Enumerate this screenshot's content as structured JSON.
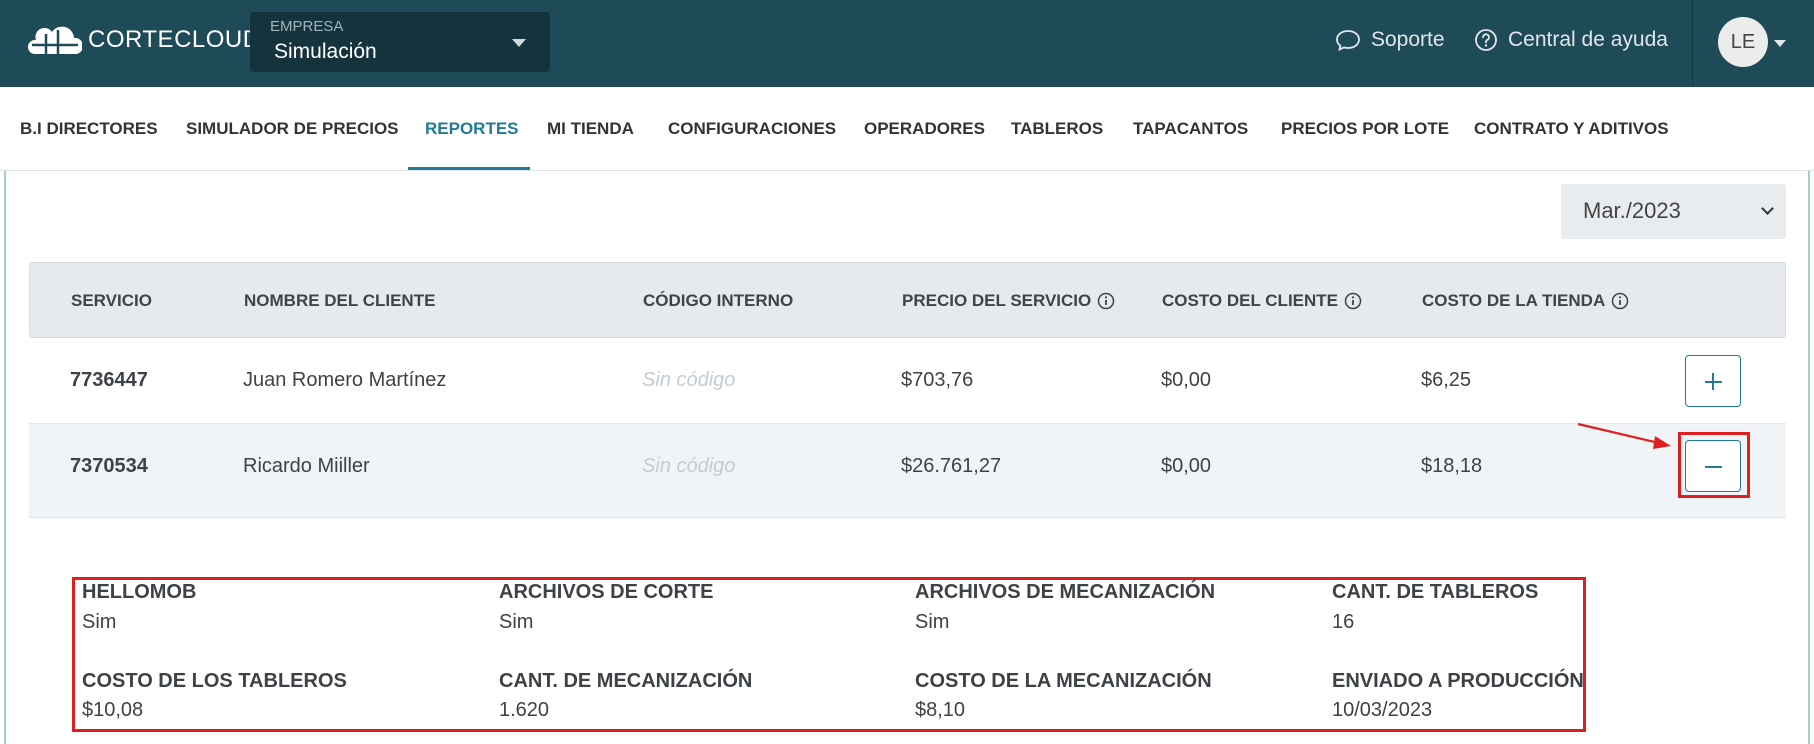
{
  "header": {
    "logo_text": "CORTECLOUD",
    "company_label": "EMPRESA",
    "company_value": "Simulación",
    "support_label": "Soporte",
    "help_label": "Central de ayuda",
    "avatar_initials": "LE"
  },
  "nav": {
    "items": [
      "B.I DIRECTORES",
      "SIMULADOR DE PRECIOS",
      "REPORTES",
      "MI TIENDA",
      "CONFIGURACIONES",
      "OPERADORES",
      "TABLEROS",
      "TAPACANTOS",
      "PRECIOS POR LOTE",
      "CONTRATO Y ADITIVOS"
    ],
    "active": "REPORTES"
  },
  "filter": {
    "month": "Mar./2023"
  },
  "table": {
    "columns": [
      "SERVICIO",
      "NOMBRE DEL CLIENTE",
      "CÓDIGO INTERNO",
      "PRECIO DEL SERVICIO",
      "COSTO DEL CLIENTE",
      "COSTO DE LA TIENDA"
    ],
    "rows": [
      {
        "service": "7736447",
        "client": "Juan Romero Martínez",
        "code": "Sin código",
        "price": "$703,76",
        "client_cost": "$0,00",
        "store_cost": "$6,25",
        "expanded": false
      },
      {
        "service": "7370534",
        "client": "Ricardo Miiller",
        "code": "Sin código",
        "price": "$26.761,27",
        "client_cost": "$0,00",
        "store_cost": "$18,18",
        "expanded": true
      }
    ]
  },
  "details": [
    {
      "label": "HELLOMOB",
      "value": "Sim"
    },
    {
      "label": "ARCHIVOS DE CORTE",
      "value": "Sim"
    },
    {
      "label": "ARCHIVOS DE MECANIZACIÓN",
      "value": "Sim"
    },
    {
      "label": "CANT. DE TABLEROS",
      "value": "16"
    },
    {
      "label": "COSTO DE LOS TABLEROS",
      "value": "$10,08"
    },
    {
      "label": "CANT. DE MECANIZACIÓN",
      "value": "1.620"
    },
    {
      "label": "COSTO DE LA MECANIZACIÓN",
      "value": "$8,10"
    },
    {
      "label": "ENVIADO A PRODUCCIÓN",
      "value": "10/03/2023"
    }
  ],
  "colors": {
    "topbar": "#1f4a57",
    "accent": "#227a94",
    "highlight": "#e02020"
  }
}
